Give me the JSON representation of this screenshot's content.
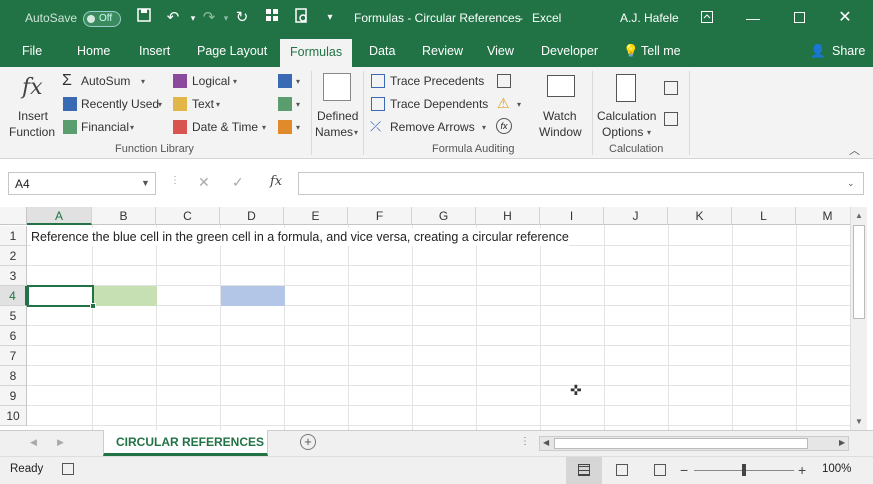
{
  "titlebar": {
    "autosave_label": "AutoSave",
    "autosave_state": "Off",
    "doc_title": "Formulas - Circular References",
    "app_name": "Excel",
    "user_name": "A.J. Hafele",
    "color": "#217346"
  },
  "tabs": [
    "File",
    "Home",
    "Insert",
    "Page Layout",
    "Formulas",
    "Data",
    "Review",
    "View",
    "Developer",
    "Tell me",
    "Share"
  ],
  "active_tab": "Formulas",
  "ribbon": {
    "insert_function": [
      "Insert",
      "Function"
    ],
    "autosum": "AutoSum",
    "recently_used": "Recently Used",
    "financial": "Financial",
    "logical": "Logical",
    "text": "Text",
    "date_time": "Date & Time",
    "defined_names": [
      "Defined",
      "Names"
    ],
    "trace_precedents": "Trace Precedents",
    "trace_dependents": "Trace Dependents",
    "remove_arrows": "Remove Arrows",
    "watch_window": [
      "Watch",
      "Window"
    ],
    "calc_options": [
      "Calculation",
      "Options"
    ],
    "group_function_library": "Function Library",
    "group_formula_auditing": "Formula Auditing",
    "group_calculation": "Calculation"
  },
  "formula_bar": {
    "name_box": "A4",
    "fx": "fx",
    "formula": ""
  },
  "grid": {
    "columns": [
      "A",
      "B",
      "C",
      "D",
      "E",
      "F",
      "G",
      "H",
      "I",
      "J",
      "K",
      "L",
      "M"
    ],
    "rows": [
      "1",
      "2",
      "3",
      "4",
      "5",
      "6",
      "7",
      "8",
      "9",
      "10"
    ],
    "selected_column": "A",
    "selected_row": "4",
    "a1_text": "Reference the blue cell in the green cell in a formula, and vice versa, creating a circular reference",
    "green_fill": "#c6e0b4",
    "blue_fill": "#b4c6e7"
  },
  "sheet_tab": "CIRCULAR REFERENCES",
  "status": {
    "ready": "Ready",
    "zoom": "100%"
  }
}
